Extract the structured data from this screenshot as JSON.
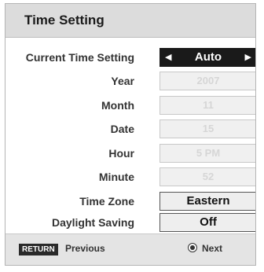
{
  "window": {
    "title": "Time Setting"
  },
  "settings": [
    {
      "label": "Current Time Setting",
      "value": "Auto",
      "state": "active",
      "left_arrow": "◀",
      "right_arrow": "▶"
    },
    {
      "label": "Year",
      "value": "2007",
      "state": "disabled"
    },
    {
      "label": "Month",
      "value": "11",
      "state": "disabled"
    },
    {
      "label": "Date",
      "value": "15",
      "state": "disabled"
    },
    {
      "label": "Hour",
      "value": "5 PM",
      "state": "disabled"
    },
    {
      "label": "Minute",
      "value": "52",
      "state": "disabled"
    },
    {
      "label": "Time Zone",
      "value": "Eastern",
      "state": "enabled"
    },
    {
      "label": "Daylight Saving",
      "value": "Off",
      "state": "enabled"
    }
  ],
  "footer": {
    "return_key": "RETURN",
    "previous_label": "Previous",
    "ok_icon": "ok-button-icon",
    "next_label": "Next"
  }
}
